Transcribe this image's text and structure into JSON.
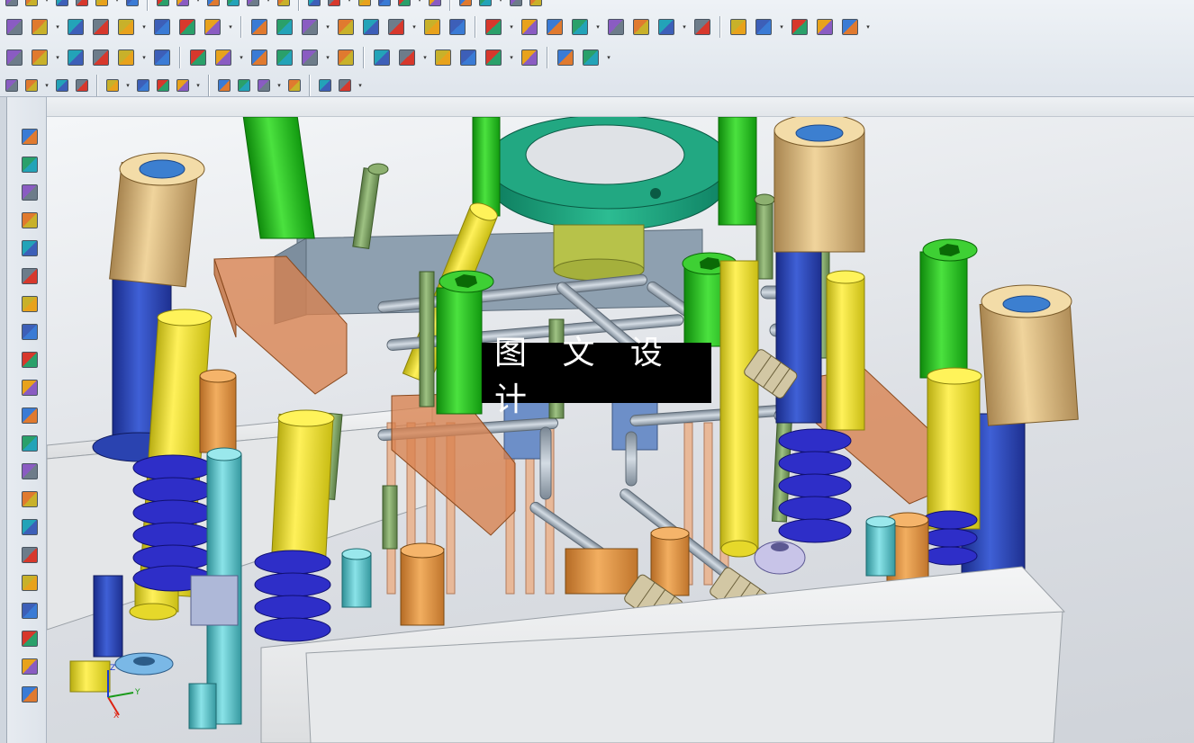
{
  "app": {
    "name": "3D CAD modeling application"
  },
  "watermark": {
    "text": "图 文 设 计"
  },
  "toolbar_row1": {
    "icons": [
      "undo-icon",
      "move-face-icon",
      "offset-face-icon",
      "delete-face-icon",
      "replace-face-icon",
      "pull-face-icon",
      "resize-face-icon",
      "constrain-face-icon",
      "triangle-icon",
      "table-icon",
      "add-in-icon",
      "array-icon",
      "sketch-icon",
      "cylinder-icon",
      "mold-icon",
      "block-icon",
      "extrude-icon",
      "face-icon",
      "pad-icon",
      "dimension-icon",
      "parts-icon",
      "pocket-icon",
      "route-icon",
      "plane-icon",
      "curve-icon",
      "solid-icon",
      "surface-icon",
      "trim-icon",
      "blend-icon"
    ]
  },
  "toolbar_row2": {
    "icons": [
      "mold-wizard-icon",
      "part-tool-icon",
      "layout-icon",
      "mold-base-icon",
      "standard-parts-icon",
      "ejector-icon",
      "slider-icon",
      "doc-tool-icon",
      "wcs-icon",
      "sub-insert-icon",
      "boss-icon",
      "parting-icon",
      "repair-icon",
      "cooling-icon",
      "bom-icon",
      "electrode-icon",
      "drawing-icon",
      "eye-icon",
      "view-icon",
      "report-icon"
    ]
  },
  "toolbar_row3": {
    "icons": [
      "snap-icon",
      "select-box-icon",
      "solid-view-icon",
      "shade-icon",
      "point-icon",
      "endpoint-icon",
      "midpoint-icon",
      "line-icon",
      "arc-icon",
      "center-icon",
      "circle-icon",
      "intersection-icon",
      "tangent-icon",
      "grid-icon"
    ]
  },
  "left_tools": {
    "icons": [
      "part-navigator-icon",
      "assembly-navigator-icon",
      "constraint-icon",
      "history-icon",
      "red-solid-icon",
      "surface-tool-icon",
      "face-tool-icon",
      "plate-icon",
      "pattern-icon",
      "check-icon",
      "measure-icon",
      "analysis-icon",
      "block-tool-icon",
      "box-icon",
      "section-icon",
      "shade-tool-icon",
      "mold-tool-icon",
      "assembly-tool-icon",
      "roles-icon",
      "history-browser-icon",
      "web-icon"
    ]
  },
  "triad": {
    "x_label": "X",
    "y_label": "Y",
    "z_label": "Z"
  },
  "colors": {
    "toolbar_bg": "#e6ebf1",
    "viewport_bg": "#dcdfe4",
    "mold_plate": "#eceeef",
    "green_bolt": "#22c01e",
    "yellow_pin": "#ece224",
    "blue_column": "#2d48b8",
    "spring": "#2e2ec8",
    "tan_bushing": "#d8b57e",
    "orange_pin": "#e59a45",
    "cyan_pin": "#57c2c8",
    "orange_block": "#d9824e"
  }
}
